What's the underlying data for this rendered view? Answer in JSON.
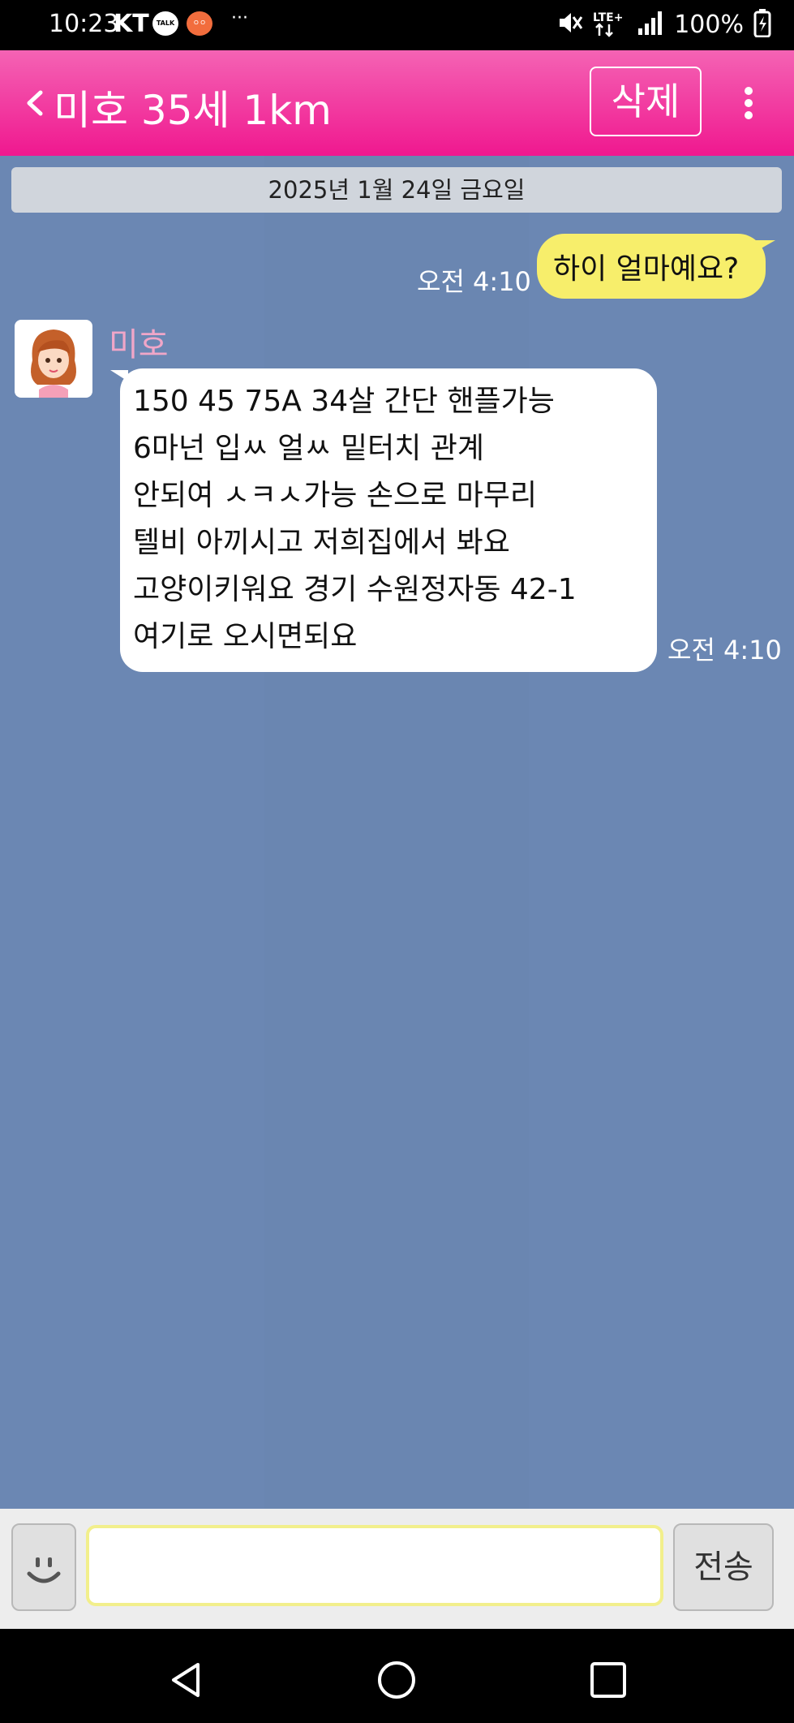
{
  "status_bar": {
    "time": "10:23",
    "carrier": "KT",
    "talk_icon_text": "TALK",
    "app_icon_text": "ㅇㅇ",
    "more_dots": "···",
    "battery": "100%",
    "network": "LTE+",
    "icons": [
      "talk-icon",
      "app-icon",
      "mute-icon",
      "lte-icon",
      "signal-icon",
      "battery-icon"
    ]
  },
  "header": {
    "title": "미호 35세 1km",
    "delete_label": "삭제",
    "icons": [
      "back-icon",
      "overflow-menu-icon"
    ],
    "color": "#f0188f"
  },
  "chat": {
    "date": "2025년 1월 24일 금요일",
    "messages": [
      {
        "direction": "outgoing",
        "text": "하이 얼마예요?",
        "time": "오전 4:10"
      },
      {
        "direction": "incoming",
        "sender": "미호",
        "lines": [
          "150 45 75A 34살 간단 핸플가능",
          "6마넌 입ㅆ 얼ㅆ 밑터치 관계",
          "안되여 ㅅㅋㅅ가능 손으로 마무리",
          "텔비 아끼시고 저희집에서 봐요",
          "고양이키워요 경기 수원정자동 42-1",
          "여기로 오시면되요"
        ],
        "time": "오전 4:10"
      }
    ]
  },
  "input_bar": {
    "placeholder": "",
    "send_label": "전송",
    "icons": [
      "smiley-icon"
    ]
  },
  "nav_bar": {
    "icons": [
      "back-triangle-icon",
      "home-circle-icon",
      "recents-square-icon"
    ]
  },
  "colors": {
    "chat_background": "#6b87b3",
    "outgoing_bubble": "#f7ee6b",
    "incoming_bubble": "#ffffff",
    "sender_name": "#f0a6c8"
  }
}
